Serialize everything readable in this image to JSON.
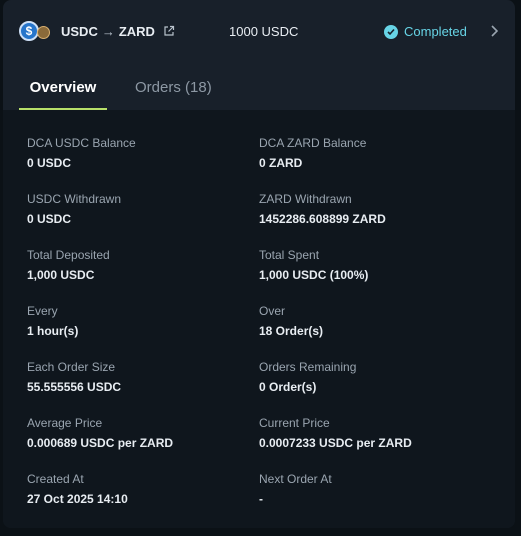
{
  "header": {
    "from_token": "USDC",
    "arrow": "→",
    "to_token": "ZARD",
    "amount": "1000 USDC",
    "status": "Completed"
  },
  "tabs": [
    {
      "label": "Overview"
    },
    {
      "label": "Orders (18)"
    }
  ],
  "details": [
    {
      "label": "DCA USDC Balance",
      "value": "0 USDC"
    },
    {
      "label": "DCA ZARD Balance",
      "value": "0 ZARD"
    },
    {
      "label": "USDC Withdrawn",
      "value": "0 USDC"
    },
    {
      "label": "ZARD Withdrawn",
      "value": "1452286.608899 ZARD"
    },
    {
      "label": "Total Deposited",
      "value": "1,000 USDC"
    },
    {
      "label": "Total Spent",
      "value": "1,000 USDC (100%)"
    },
    {
      "label": "Every",
      "value": "1 hour(s)"
    },
    {
      "label": "Over",
      "value": "18 Order(s)"
    },
    {
      "label": "Each Order Size",
      "value": "55.555556 USDC"
    },
    {
      "label": "Orders Remaining",
      "value": "0 Order(s)"
    },
    {
      "label": "Average Price",
      "value": "0.000689 USDC per ZARD"
    },
    {
      "label": "Current Price",
      "value": "0.0007233 USDC per ZARD"
    },
    {
      "label": "Created At",
      "value": "27 Oct 2025 14:10"
    },
    {
      "label": "Next Order At",
      "value": "-"
    }
  ],
  "colors": {
    "accent": "#b8e06a",
    "status": "#67d4e6",
    "usdc": "#2775ca"
  }
}
